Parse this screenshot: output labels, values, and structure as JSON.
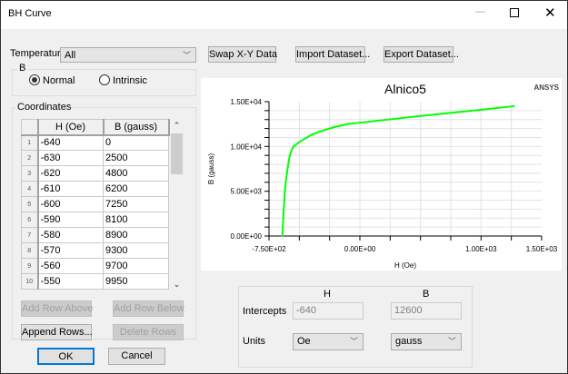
{
  "window": {
    "title": "BH Curve",
    "controls": [
      "minimize",
      "maximize",
      "close"
    ]
  },
  "temperature": {
    "label": "Temperature",
    "value": "All"
  },
  "toolbar": {
    "swap": "Swap X-Y Data",
    "import": "Import Dataset...",
    "export": "Export Dataset..."
  },
  "b_group": {
    "label": "B",
    "options": [
      {
        "label": "Normal",
        "selected": true
      },
      {
        "label": "Intrinsic",
        "selected": false
      }
    ]
  },
  "coordinates": {
    "label": "Coordinates",
    "headers": [
      "H (Oe)",
      "B (gauss)"
    ],
    "rows": [
      [
        "1",
        "-640",
        "0"
      ],
      [
        "2",
        "-630",
        "2500"
      ],
      [
        "3",
        "-620",
        "4800"
      ],
      [
        "4",
        "-610",
        "6200"
      ],
      [
        "5",
        "-600",
        "7250"
      ],
      [
        "6",
        "-590",
        "8100"
      ],
      [
        "7",
        "-580",
        "8900"
      ],
      [
        "8",
        "-570",
        "9300"
      ],
      [
        "9",
        "-560",
        "9700"
      ],
      [
        "10",
        "-550",
        "9950"
      ]
    ]
  },
  "row_buttons": {
    "add_above": "Add Row Above",
    "add_below": "Add Row Below",
    "append": "Append Rows...",
    "delete": "Delete Rows"
  },
  "dialog_buttons": {
    "ok": "OK",
    "cancel": "Cancel"
  },
  "intercepts": {
    "col_h": "H",
    "col_b": "B",
    "label": "Intercepts",
    "h": "-640",
    "b": "12600",
    "units_label": "Units",
    "h_unit": "Oe",
    "b_unit": "gauss"
  },
  "chart_data": {
    "type": "line",
    "title": "Alnico5",
    "logo": "ANSYS",
    "xlabel": "H (Oe)",
    "ylabel": "B (gauss)",
    "xlim": [
      -750,
      1500
    ],
    "ylim": [
      0,
      15000
    ],
    "xticks": [
      "-7.50E+02",
      "0.00E+00",
      "1.00E+03",
      "1.50E+03"
    ],
    "xtick_values": [
      -750,
      0,
      1000,
      1500
    ],
    "yticks": [
      "0.00E+00",
      "5.00E+03",
      "1.00E+04",
      "1.50E+04"
    ],
    "ytick_values": [
      0,
      5000,
      10000,
      15000
    ],
    "grid": true,
    "color": "#00ff00",
    "x": [
      -640,
      -630,
      -620,
      -610,
      -600,
      -590,
      -580,
      -570,
      -560,
      -550,
      -500,
      -400,
      -300,
      -200,
      -100,
      0,
      500,
      1000,
      1275
    ],
    "y": [
      0,
      2500,
      4800,
      6200,
      7250,
      8100,
      8900,
      9300,
      9700,
      9950,
      10500,
      11300,
      11800,
      12200,
      12500,
      12650,
      13400,
      14100,
      14500
    ]
  }
}
